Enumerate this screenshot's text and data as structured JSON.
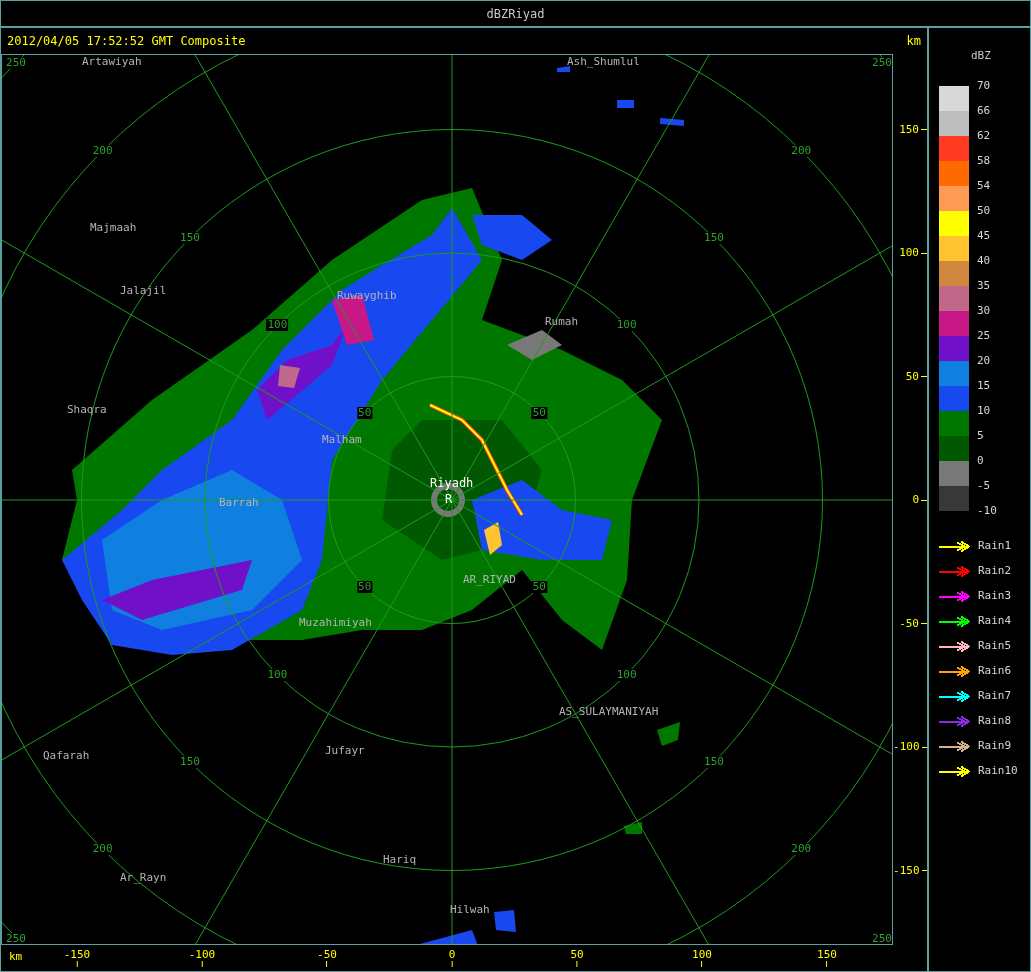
{
  "window": {
    "title": "dBZRiyad"
  },
  "header": {
    "timestamp": "2012/04/05 17:52:52 GMT Composite",
    "unit": "km"
  },
  "map": {
    "range_rings": [
      {
        "labels": [
          "50",
          "50",
          "50",
          "50"
        ]
      },
      {
        "labels": [
          "100",
          "100",
          "100",
          "100"
        ]
      },
      {
        "labels": [
          "150",
          "150",
          "150",
          "150"
        ]
      },
      {
        "labels": [
          "200",
          "200",
          "200",
          "200"
        ]
      },
      {
        "labels": [
          "250",
          "250",
          "250",
          "250"
        ]
      }
    ],
    "places": [
      {
        "name": "Artawiyah",
        "kind": "town"
      },
      {
        "name": "Ash_Shumlul",
        "kind": "town"
      },
      {
        "name": "Majmaah",
        "kind": "town"
      },
      {
        "name": "Jalajil",
        "kind": "town"
      },
      {
        "name": "Ruwayghib",
        "kind": "town"
      },
      {
        "name": "Rumah",
        "kind": "town"
      },
      {
        "name": "Shaqra",
        "kind": "town"
      },
      {
        "name": "Malham",
        "kind": "town"
      },
      {
        "name": "Riyadh",
        "kind": "station"
      },
      {
        "name": "R",
        "kind": "station"
      },
      {
        "name": "Barrah",
        "kind": "town"
      },
      {
        "name": "AR_RIYAD",
        "kind": "town"
      },
      {
        "name": "Muzahimiyah",
        "kind": "town"
      },
      {
        "name": "AS_SULAYMANIYAH",
        "kind": "town"
      },
      {
        "name": "Qafarah",
        "kind": "town"
      },
      {
        "name": "Jufayr",
        "kind": "town"
      },
      {
        "name": "Hariq",
        "kind": "town"
      },
      {
        "name": "Ar_Rayn",
        "kind": "town"
      },
      {
        "name": "Hilwah",
        "kind": "town"
      }
    ]
  },
  "y_axis": {
    "ticks": [
      "150",
      "100",
      "50",
      "0",
      "-50",
      "-100",
      "-150"
    ]
  },
  "x_axis": {
    "unit": "km",
    "ticks": [
      "-150",
      "-100",
      "-50",
      "0",
      "50",
      "100",
      "150"
    ]
  },
  "legend": {
    "title": "dBZ",
    "scale": [
      {
        "color": "#d8d8d8"
      },
      {
        "color": "#bdbdbd"
      },
      {
        "color": "#ff3a20"
      },
      {
        "color": "#ff6a00"
      },
      {
        "color": "#ff9a55"
      },
      {
        "color": "#ffff00"
      },
      {
        "color": "#ffc430"
      },
      {
        "color": "#d08840"
      },
      {
        "color": "#c06888"
      },
      {
        "color": "#c81888"
      },
      {
        "color": "#7010c8"
      },
      {
        "color": "#1080e0"
      },
      {
        "color": "#1848f0"
      },
      {
        "color": "#007800"
      },
      {
        "color": "#005800"
      },
      {
        "color": "#787878"
      },
      {
        "color": "#383838"
      }
    ],
    "labels": [
      "70",
      "66",
      "62",
      "58",
      "54",
      "50",
      "45",
      "40",
      "35",
      "30",
      "25",
      "20",
      "15",
      "10",
      "5",
      "0",
      "-5",
      "-10"
    ],
    "tracks": [
      {
        "name": "Rain1",
        "color": "#ffff00"
      },
      {
        "name": "Rain2",
        "color": "#ff0000"
      },
      {
        "name": "Rain3",
        "color": "#ff00ff"
      },
      {
        "name": "Rain4",
        "color": "#00ff00"
      },
      {
        "name": "Rain5",
        "color": "#ffb6c1"
      },
      {
        "name": "Rain6",
        "color": "#ffa500"
      },
      {
        "name": "Rain7",
        "color": "#00ffff"
      },
      {
        "name": "Rain8",
        "color": "#8a2be2"
      },
      {
        "name": "Rain9",
        "color": "#d2b48c"
      },
      {
        "name": "Rain10",
        "color": "#ffff00"
      }
    ]
  }
}
